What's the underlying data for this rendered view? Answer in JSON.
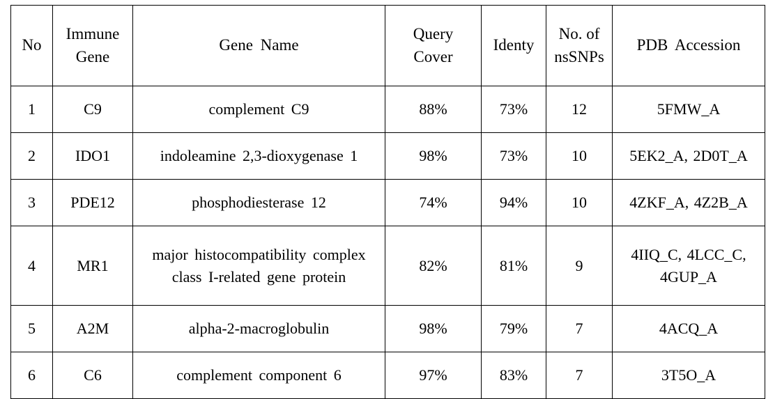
{
  "table": {
    "caption": "",
    "columns": [
      {
        "key": "no",
        "label_lines": [
          "No"
        ]
      },
      {
        "key": "gene",
        "label_lines": [
          "Immune",
          "Gene"
        ]
      },
      {
        "key": "name",
        "label_lines": [
          "Gene  Name"
        ]
      },
      {
        "key": "query",
        "label_lines": [
          "Query",
          "Cover"
        ]
      },
      {
        "key": "ident",
        "label_lines": [
          "Identy"
        ]
      },
      {
        "key": "snps",
        "label_lines": [
          "No.  of",
          "nsSNPs"
        ]
      },
      {
        "key": "pdb",
        "label_lines": [
          "PDB  Accession"
        ]
      }
    ],
    "rows": [
      {
        "no": "1",
        "gene": "C9",
        "name_lines": [
          "complement  C9"
        ],
        "query": "88%",
        "ident": "73%",
        "snps": "12",
        "pdb_lines": [
          "5FMW_A"
        ]
      },
      {
        "no": "2",
        "gene": "IDO1",
        "name_lines": [
          "indoleamine  2,3-dioxygenase  1"
        ],
        "query": "98%",
        "ident": "73%",
        "snps": "10",
        "pdb_lines": [
          "5EK2_A, 2D0T_A"
        ]
      },
      {
        "no": "3",
        "gene": "PDE12",
        "name_lines": [
          "phosphodiesterase  12"
        ],
        "query": "74%",
        "ident": "94%",
        "snps": "10",
        "pdb_lines": [
          "4ZKF_A, 4Z2B_A"
        ]
      },
      {
        "no": "4",
        "gene": "MR1",
        "name_lines": [
          "major  histocompatibility  complex",
          "class  I-related  gene  protein"
        ],
        "query": "82%",
        "ident": "81%",
        "snps": "9",
        "pdb_lines": [
          "4IIQ_C, 4LCC_C,",
          "4GUP_A"
        ]
      },
      {
        "no": "5",
        "gene": "A2M",
        "name_lines": [
          "alpha-2-macroglobulin"
        ],
        "query": "98%",
        "ident": "79%",
        "snps": "7",
        "pdb_lines": [
          "4ACQ_A"
        ]
      },
      {
        "no": "6",
        "gene": "C6",
        "name_lines": [
          "complement  component  6"
        ],
        "query": "97%",
        "ident": "83%",
        "snps": "7",
        "pdb_lines": [
          "3T5O_A"
        ]
      }
    ]
  },
  "style": {
    "border_color": "#000000",
    "text_color": "#000000",
    "background": "#ffffff"
  }
}
